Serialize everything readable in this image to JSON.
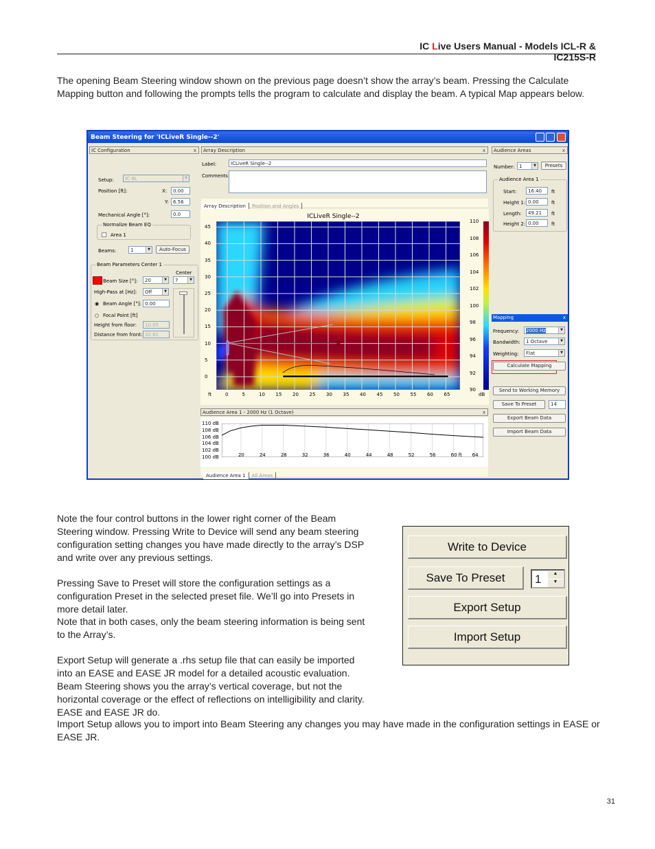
{
  "header": {
    "prefix": "IC ",
    "accent_letter": "L",
    "rest": "ive Users Manual - Models  ICL-R & IC215S-R",
    "accent_color": "#e2231a"
  },
  "intro": "The opening Beam Steering window shown on the previous page doesn’t show the array’s beam. Pressing the Calculate Mapping button and following the prompts tells the program to calculate and display the beam. A typical Map appears below.",
  "window": {
    "title": "Beam Steering for 'ICLiveR Single--2'",
    "ic_config": {
      "header": "IC Configuration",
      "setup_label": "Setup:",
      "setup_value": "IC-8L",
      "position_label": "Position [ft]:",
      "x_label": "X:",
      "x_value": "0.00",
      "y_label": "Y:",
      "y_value": "6.56",
      "mech_label": "Mechanical Angle [°]:",
      "mech_value": "0.0",
      "normalize_group": "Normalize Beam EQ",
      "area_checkbox": "Area 1",
      "beams_label": "Beams:",
      "beams_value": "1",
      "autofocus": "Auto-Focus",
      "params_group": "Beam Parameters Center 1",
      "center_label": "Center",
      "center_value": "7",
      "beam_size_label": "Beam Size [°]:",
      "beam_size_value": "20",
      "highpass_label": "High-Pass at [Hz]:",
      "highpass_value": "Off",
      "beam_angle_label": "Beam Angle [°]:",
      "beam_angle_value": "0.00",
      "focal_label": "Focal Point [ft]",
      "height_label": "Height from floor:",
      "height_value": "10.05",
      "distance_label": "Distance from front:",
      "distance_value": "32.81",
      "beam_color": "#ff0000"
    },
    "array_desc": {
      "header": "Array Description",
      "label_label": "Label:",
      "label_value": "ICLiveR Single--2",
      "comments_label": "Comments:",
      "comments_value": "",
      "tabs": [
        "Array Description",
        "Position and Angles"
      ]
    },
    "map": {
      "title": "ICLiveR Single--2",
      "x_unit": "ft",
      "y_ticks": [
        "45",
        "40",
        "35",
        "30",
        "25",
        "20",
        "15",
        "10",
        "5",
        "0"
      ],
      "x_ticks": [
        "0",
        "5",
        "10",
        "15",
        "20",
        "25",
        "30",
        "35",
        "40",
        "45",
        "50",
        "55",
        "60",
        "65"
      ],
      "colorbar_ticks": [
        "110",
        "108",
        "106",
        "104",
        "102",
        "100",
        "98",
        "96",
        "94",
        "92",
        "90"
      ],
      "colorbar_unit": "dB"
    },
    "audience_plot": {
      "header": "Audience Area 1 - 2000 Hz (1 Octave)",
      "y_ticks": [
        "110 dB",
        "108 dB",
        "106 dB",
        "104 dB",
        "102 dB",
        "100 dB"
      ],
      "x_ticks": [
        "20",
        "24",
        "28",
        "32",
        "36",
        "40",
        "44",
        "48",
        "52",
        "56",
        "60 ft",
        "64"
      ],
      "tabs": [
        "Audience Area 1",
        "All Areas"
      ],
      "chart_data": {
        "type": "line",
        "x": [
          16.4,
          18,
          20,
          22,
          24,
          28,
          32,
          36,
          40,
          44,
          48,
          52,
          56,
          60,
          65.6
        ],
        "y": [
          106.5,
          107.8,
          108.7,
          109.2,
          109.5,
          109.5,
          109.2,
          108.9,
          108.5,
          108.1,
          107.7,
          107.3,
          106.8,
          106.4,
          105.9
        ],
        "ylim": [
          100,
          110
        ],
        "xlim": [
          16.4,
          65.6
        ]
      }
    },
    "audience_areas": {
      "header": "Audience Areas",
      "number_label": "Number:",
      "number_value": "1",
      "presets": "Presets",
      "group": "Audience Area 1",
      "start_label": "Start:",
      "start_value": "16.40",
      "h1_label": "Height 1:",
      "h1_value": "0.00",
      "length_label": "Length:",
      "length_value": "49.21",
      "h2_label": "Height 2:",
      "h2_value": "0.00",
      "unit": "ft"
    },
    "mapping": {
      "header": "Mapping",
      "freq_label": "Frequency:",
      "freq_value": "2000 Hz",
      "bw_label": "Bandwidth:",
      "bw_value": "1 Octave",
      "weight_label": "Weighting:",
      "weight_value": "Flat",
      "calculate": "Calculate Mapping",
      "highlight_color": "#d9232e"
    },
    "actions": {
      "send": "Send to Working Memory",
      "save": "Save To Preset",
      "save_num": "14",
      "export": "Export Beam Data",
      "import": "Import Beam Data"
    }
  },
  "body_paras": [
    "Note the four control buttons in the lower right corner of the Beam Steering window. Pressing Write to Device will send any beam steering configuration setting changes you have made directly to the array’s DSP and write over any previous settings.",
    "Pressing Save to Preset will store the configuration settings as a configuration Preset in the selected preset file. We’ll go into Presets in more detail later.",
    "Note that in both cases, only the beam steering information is being sent to the Array’s.",
    "Export Setup will generate a .rhs setup file that can easily be imported into an EASE and EASE JR model for a detailed acoustic evaluation. Beam Steering shows you the array’s vertical coverage, but not the horizontal coverage or the effect of reflections on intelligibility and clarity. EASE and EASE JR do."
  ],
  "final_para": "Import Setup allows you to import into Beam Steering any changes you may have made in the configuration settings in EASE or EASE JR.",
  "buttons": {
    "write": "Write to Device",
    "save": "Save To Preset",
    "preset_num": "1",
    "export": "Export Setup",
    "import": "Import Setup"
  },
  "page_number": "31"
}
